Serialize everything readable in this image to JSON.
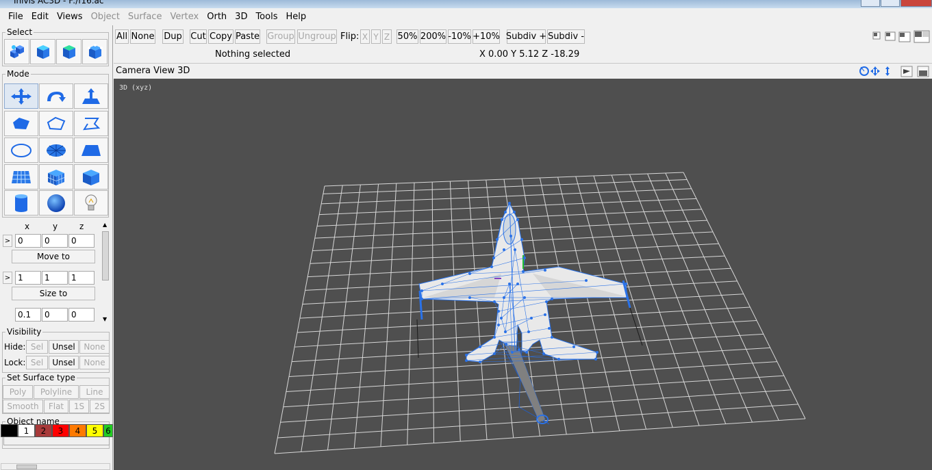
{
  "window": {
    "title": "Inivis AC3D - F:/f16.ac"
  },
  "menu": [
    {
      "label": "File",
      "enabled": true
    },
    {
      "label": "Edit",
      "enabled": true
    },
    {
      "label": "Views",
      "enabled": true
    },
    {
      "label": "Object",
      "enabled": false
    },
    {
      "label": "Surface",
      "enabled": false
    },
    {
      "label": "Vertex",
      "enabled": false
    },
    {
      "label": "Orth",
      "enabled": true
    },
    {
      "label": "3D",
      "enabled": true
    },
    {
      "label": "Tools",
      "enabled": true
    },
    {
      "label": "Help",
      "enabled": true
    }
  ],
  "left": {
    "select_label": "Select",
    "mode_label": "Mode",
    "coords": {
      "headers": [
        "x",
        "y",
        "z"
      ],
      "arrow": ">",
      "pos": [
        "0",
        "0",
        "0"
      ],
      "move_to": "Move to",
      "size": [
        "1",
        "1",
        "1"
      ],
      "size_to": "Size to",
      "extra": [
        "0.1",
        "0",
        "0"
      ]
    },
    "visibility": {
      "label": "Visibility",
      "hide_label": "Hide:",
      "lock_label": "Lock:",
      "sel": "Sel",
      "unsel": "Unsel",
      "none": "None"
    },
    "surface_type": {
      "label": "Set Surface type",
      "poly": "Poly",
      "polyline": "Polyline",
      "line": "Line",
      "smooth": "Smooth",
      "flat": "Flat",
      "one_s": "1S",
      "two_s": "2S"
    },
    "object_name": {
      "label": "Object name",
      "value": ""
    },
    "palette": [
      {
        "label": "",
        "color": "#000000",
        "fg": "#ffffff"
      },
      {
        "label": "1",
        "color": "#ffffff",
        "fg": "#000000"
      },
      {
        "label": "2",
        "color": "#a83a3a",
        "fg": "#000000"
      },
      {
        "label": "3",
        "color": "#ff0000",
        "fg": "#000000"
      },
      {
        "label": "4",
        "color": "#ff7a00",
        "fg": "#000000"
      },
      {
        "label": "5",
        "color": "#ffff00",
        "fg": "#000000"
      },
      {
        "label": "6",
        "color": "#22cc22",
        "fg": "#000000"
      }
    ]
  },
  "toolbar": {
    "all": "All",
    "none": "None",
    "dup": "Dup",
    "cut": "Cut",
    "copy": "Copy",
    "paste": "Paste",
    "group": "Group",
    "ungroup": "Ungroup",
    "flip_label": "Flip:",
    "flip_x": "X",
    "flip_y": "Y",
    "flip_z": "Z",
    "z50": "50%",
    "z200": "200%",
    "zm10": "-10%",
    "zp10": "+10%",
    "subdiv_plus": "Subdiv +",
    "subdiv_minus": "Subdiv -",
    "status": "Nothing selected",
    "coords": "X 0.00 Y 5.12 Z -18.29"
  },
  "viewport": {
    "header": "Camera  View  3D",
    "label": "3D (xyz)",
    "bg_color": "#4f4f4f",
    "grid_color": "#d8d8d8",
    "wire_color": "#2a72e8"
  }
}
